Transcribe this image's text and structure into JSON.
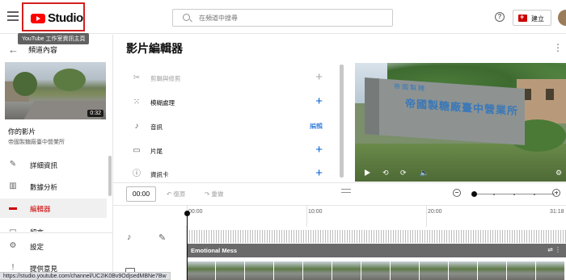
{
  "header": {
    "logo_text": "Studio",
    "logo_tooltip": "YouTube 工作室資訊主頁",
    "search_placeholder": "在頻道中搜尋",
    "help_label": "?",
    "create_label": "建立"
  },
  "sidebar": {
    "back_label": "頻道內容",
    "thumbnail_duration": "0:32",
    "your_video_label": "你的影片",
    "video_title": "帝國製糖廠臺中營業所",
    "items": [
      {
        "label": "詳細資訊",
        "icon": "pencil-icon",
        "active": false
      },
      {
        "label": "數據分析",
        "icon": "analytics-icon",
        "active": false
      },
      {
        "label": "編輯器",
        "icon": "editor-icon",
        "active": true
      },
      {
        "label": "留言",
        "icon": "comments-icon",
        "active": false
      },
      {
        "label": "設定",
        "icon": "gear-icon",
        "active": false
      },
      {
        "label": "提供意見",
        "icon": "feedback-icon",
        "active": false
      }
    ]
  },
  "main": {
    "title": "影片編輯器",
    "tools": [
      {
        "label": "剪輯與修剪",
        "action": "+",
        "disabled": true
      },
      {
        "label": "模糊處理",
        "action": "+",
        "disabled": false
      },
      {
        "label": "音訊",
        "action": "編輯",
        "disabled": false
      },
      {
        "label": "片尾",
        "action": "+",
        "disabled": false
      },
      {
        "label": "資訊卡",
        "action": "+",
        "disabled": false
      }
    ]
  },
  "video_overlay": {
    "sign_top": "帝國製糖",
    "sign_main": "帝國製糖廠臺中營業所"
  },
  "timeline": {
    "current_time": "00:00",
    "undo_label": "復原",
    "redo_label": "重做",
    "ticks": [
      "00:00",
      "10:00",
      "20:00",
      "31:18"
    ],
    "music_track": "Emotional Mess"
  },
  "status_url": "https://studio.youtube.com/channel/UC2iK0Bv9OdjsedMBNe7Bw",
  "colors": {
    "accent_red": "#cc0000",
    "link_blue": "#065fd4",
    "logo_highlight_border": "#d21f1f"
  }
}
